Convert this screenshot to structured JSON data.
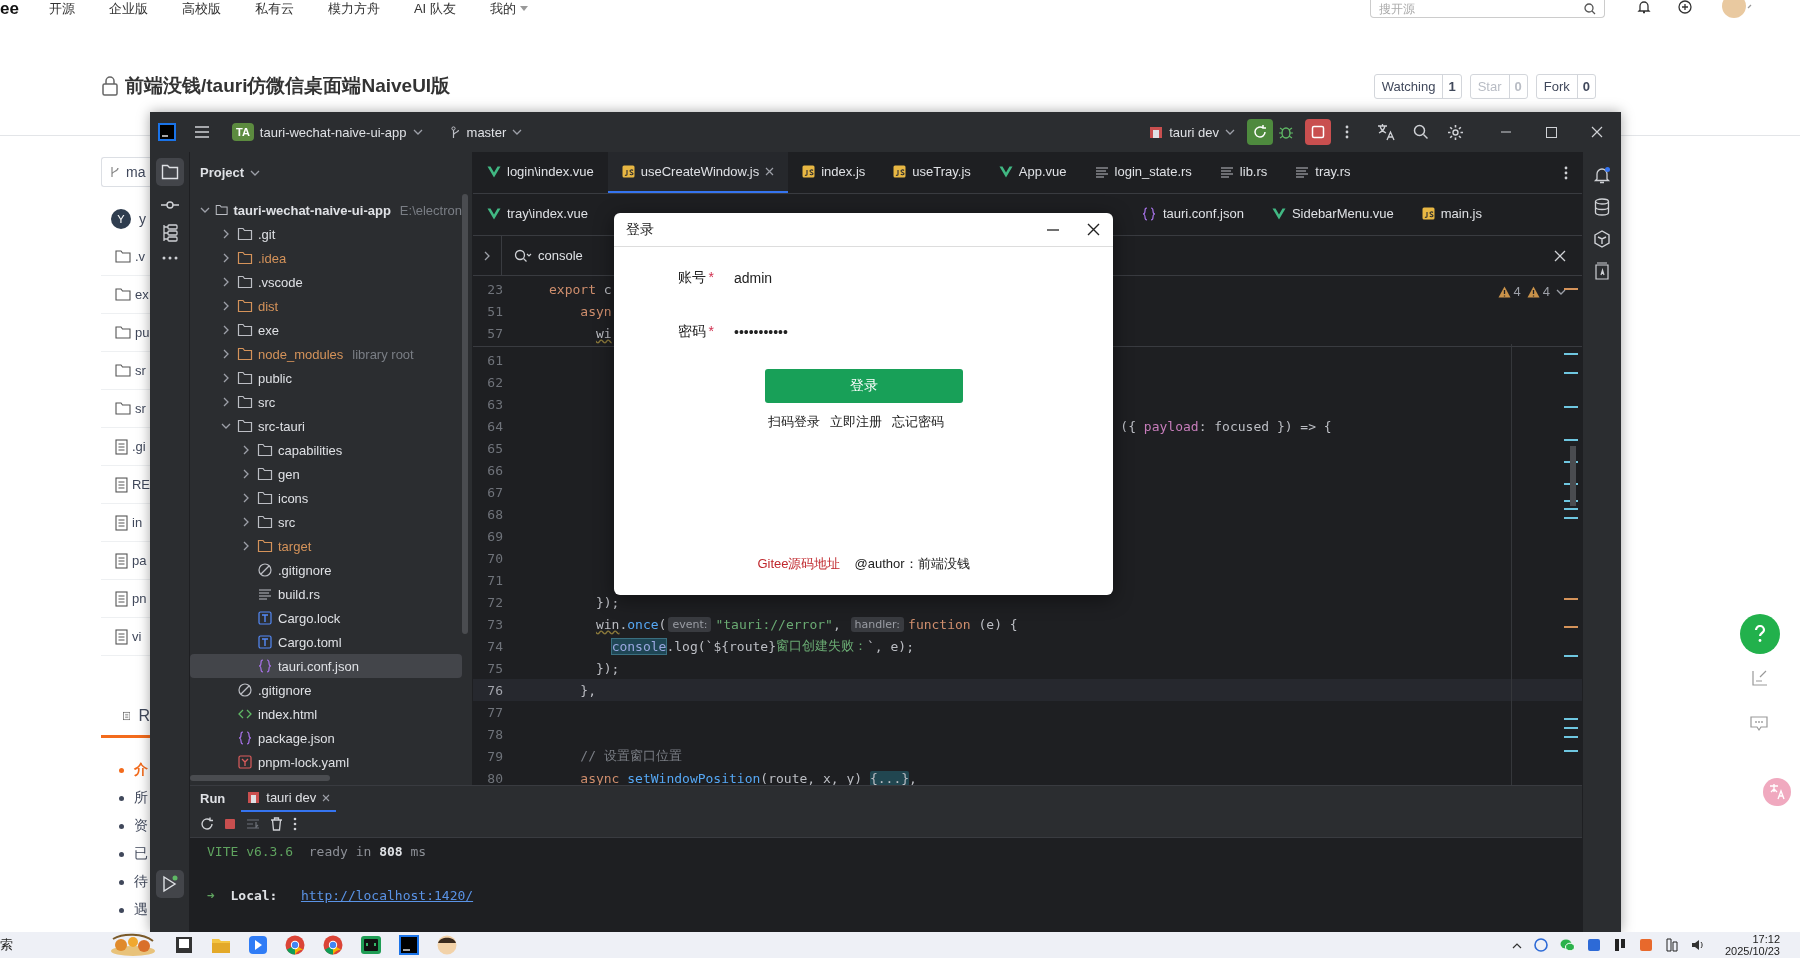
{
  "browser_page": {
    "logo": "ee",
    "nav": [
      "开源",
      "企业版",
      "高校版",
      "私有云",
      "模力方舟",
      "AI 队友",
      "我的"
    ],
    "search": {
      "placeholder": "搜开源"
    },
    "repo_title": "前端没钱/tauri仿微信桌面端NaiveUI版",
    "repo_buttons": [
      {
        "label": "Watching",
        "count": "1",
        "disabled": false
      },
      {
        "label": "Star",
        "count": "0",
        "disabled": true
      },
      {
        "label": "Fork",
        "count": "0",
        "disabled": false
      }
    ],
    "branch": "ma",
    "committer": {
      "avatar": "Y",
      "name": "y"
    },
    "files": [
      {
        "kind": "folder",
        "name": ".v"
      },
      {
        "kind": "folder",
        "name": "ex"
      },
      {
        "kind": "folder",
        "name": "pu"
      },
      {
        "kind": "folder",
        "name": "sr"
      },
      {
        "kind": "folder",
        "name": "sr"
      },
      {
        "kind": "file",
        "name": ".gi"
      },
      {
        "kind": "file",
        "name": "RE"
      },
      {
        "kind": "file",
        "name": "in"
      },
      {
        "kind": "file",
        "name": "pa"
      },
      {
        "kind": "file",
        "name": "pn"
      },
      {
        "kind": "file",
        "name": "vi"
      }
    ],
    "readme_tab": "R",
    "readme_items": [
      {
        "text": "介",
        "selected": true
      },
      {
        "text": "所",
        "selected": false
      },
      {
        "text": "资",
        "selected": false
      },
      {
        "text": "已",
        "selected": false
      },
      {
        "text": "待",
        "selected": false
      },
      {
        "text": "遇",
        "selected": false
      }
    ]
  },
  "ide": {
    "project_badge": "TA",
    "project": "tauri-wechat-naive-ui-app",
    "branch": "master",
    "run_config": "tauri dev",
    "panel_title": "Project",
    "tree": [
      {
        "name": "tauri-wechat-naive-ui-app",
        "note": "E:\\electron",
        "kind": "folder",
        "expanded": true,
        "excluded": false,
        "selected": false,
        "children": [
          {
            "name": ".git",
            "kind": "folder",
            "expanded": false,
            "excluded": false,
            "selected": false
          },
          {
            "name": ".idea",
            "kind": "folder",
            "expanded": false,
            "excluded": true,
            "selected": false
          },
          {
            "name": ".vscode",
            "kind": "folder",
            "expanded": false,
            "excluded": false,
            "selected": false
          },
          {
            "name": "dist",
            "kind": "folder",
            "expanded": false,
            "excluded": true,
            "selected": false
          },
          {
            "name": "exe",
            "kind": "folder",
            "expanded": false,
            "excluded": false,
            "selected": false
          },
          {
            "name": "node_modules",
            "note": "library root",
            "kind": "folder",
            "expanded": false,
            "excluded": true,
            "selected": false
          },
          {
            "name": "public",
            "kind": "folder",
            "expanded": false,
            "excluded": false,
            "selected": false
          },
          {
            "name": "src",
            "kind": "folder",
            "expanded": false,
            "excluded": false,
            "selected": false
          },
          {
            "name": "src-tauri",
            "kind": "folder",
            "expanded": true,
            "excluded": false,
            "selected": false,
            "children": [
              {
                "name": "capabilities",
                "kind": "folder",
                "expanded": false,
                "excluded": false,
                "selected": false
              },
              {
                "name": "gen",
                "kind": "folder",
                "expanded": false,
                "excluded": false,
                "selected": false
              },
              {
                "name": "icons",
                "kind": "folder",
                "expanded": false,
                "excluded": false,
                "selected": false
              },
              {
                "name": "src",
                "kind": "folder",
                "expanded": false,
                "excluded": false,
                "selected": false
              },
              {
                "name": "target",
                "kind": "folder",
                "expanded": false,
                "excluded": true,
                "selected": false
              },
              {
                "name": ".gitignore",
                "kind": "ignore",
                "excluded": false,
                "selected": false
              },
              {
                "name": "build.rs",
                "kind": "text",
                "excluded": false,
                "selected": false
              },
              {
                "name": "Cargo.lock",
                "kind": "toml",
                "excluded": false,
                "selected": false
              },
              {
                "name": "Cargo.toml",
                "kind": "toml",
                "excluded": false,
                "selected": false
              },
              {
                "name": "tauri.conf.json",
                "kind": "json",
                "excluded": false,
                "selected": true
              }
            ]
          },
          {
            "name": ".gitignore",
            "kind": "ignore",
            "excluded": false,
            "selected": false
          },
          {
            "name": "index.html",
            "kind": "html",
            "excluded": false,
            "selected": false
          },
          {
            "name": "package.json",
            "kind": "json",
            "excluded": false,
            "selected": false
          },
          {
            "name": "pnpm-lock.yaml",
            "kind": "yaml",
            "excluded": false,
            "selected": false
          }
        ]
      }
    ],
    "tabs": [
      {
        "label": "login\\index.vue",
        "kind": "vue",
        "selected": false
      },
      {
        "label": "useCreateWindow.js",
        "kind": "js",
        "selected": true
      },
      {
        "label": "index.js",
        "kind": "js",
        "selected": false
      },
      {
        "label": "useTray.js",
        "kind": "js",
        "selected": false
      },
      {
        "label": "App.vue",
        "kind": "vue",
        "selected": false
      },
      {
        "label": "login_state.rs",
        "kind": "rs",
        "selected": false
      },
      {
        "label": "lib.rs",
        "kind": "rs",
        "selected": false
      },
      {
        "label": "tray.rs",
        "kind": "rs",
        "selected": false
      }
    ],
    "tabs_second_row_left": [
      {
        "label": "tray\\index.vue",
        "kind": "vue",
        "selected": false
      }
    ],
    "tabs_second_row_right": [
      {
        "label": "tauri.conf.json",
        "kind": "json",
        "selected": false
      },
      {
        "label": "SidebarMenu.vue",
        "kind": "vue",
        "selected": false
      },
      {
        "label": "main.js",
        "kind": "js",
        "selected": false
      }
    ],
    "search": {
      "value": "console"
    },
    "warnings": [
      "4",
      "4"
    ],
    "sticky_lines": [
      {
        "number": "23",
        "tokens": [
          {
            "kind": "kw",
            "text": "export"
          },
          {
            "kind": "plain",
            "text": " c"
          }
        ]
      },
      {
        "number": "51",
        "tokens": [
          {
            "kind": "kw",
            "text": "    asyn"
          }
        ]
      },
      {
        "number": "57",
        "tokens": [
          {
            "kind": "squiggle",
            "text": "      wi"
          }
        ]
      }
    ],
    "lines": [
      {
        "number": "61",
        "current": false
      },
      {
        "number": "62",
        "current": false
      },
      {
        "number": "63",
        "current": false
      },
      {
        "number": "64",
        "current": false,
        "tail_tokens": [
          {
            "kind": "plain",
            "text": "({ "
          },
          {
            "kind": "prop",
            "text": "payload"
          },
          {
            "kind": "plain",
            "text": ": focused }) => {"
          }
        ]
      },
      {
        "number": "65",
        "current": false
      },
      {
        "number": "66",
        "current": false
      },
      {
        "number": "67",
        "current": false
      },
      {
        "number": "68",
        "current": false
      },
      {
        "number": "69",
        "current": false
      },
      {
        "number": "70",
        "current": false
      },
      {
        "number": "71",
        "current": false
      },
      {
        "number": "72",
        "current": false,
        "tokens": [
          {
            "kind": "plain",
            "text": "      });"
          }
        ]
      },
      {
        "number": "73",
        "current": false,
        "tokens": [
          {
            "kind": "squiggle",
            "text": "      win"
          },
          {
            "kind": "plain",
            "text": "."
          },
          {
            "kind": "fn",
            "text": "once"
          },
          {
            "kind": "plain",
            "text": "("
          },
          {
            "kind": "hint",
            "text": "event:"
          },
          {
            "kind": "str",
            "text": "\"tauri://error\""
          },
          {
            "kind": "plain",
            "text": ", "
          },
          {
            "kind": "hint",
            "text": "handler:"
          },
          {
            "kind": "kw",
            "text": "function"
          },
          {
            "kind": "plain",
            "text": " (e) {"
          }
        ]
      },
      {
        "number": "74",
        "current": false,
        "tokens": [
          {
            "kind": "match",
            "text": "        console"
          },
          {
            "kind": "plain",
            "text": ".log(`${route}"
          },
          {
            "kind": "str",
            "text": "窗口创建失败："
          },
          {
            "kind": "plain",
            "text": "`, e);"
          }
        ]
      },
      {
        "number": "75",
        "current": false,
        "tokens": [
          {
            "kind": "plain",
            "text": "      });"
          }
        ]
      },
      {
        "number": "76",
        "current": true,
        "tokens": [
          {
            "kind": "plain",
            "text": "    },"
          }
        ]
      },
      {
        "number": "77",
        "current": false
      },
      {
        "number": "78",
        "current": false
      },
      {
        "number": "79",
        "current": false,
        "tokens": [
          {
            "kind": "comment",
            "text": "    // 设置窗口位置"
          }
        ]
      },
      {
        "number": "80",
        "current": false,
        "tokens": [
          {
            "kind": "kw",
            "text": "    async"
          },
          {
            "kind": "fn",
            "text": " setWindowPosition"
          },
          {
            "kind": "plain",
            "text": "(route, x, y) "
          },
          {
            "kind": "fold",
            "text": "{...}"
          },
          {
            "kind": "plain",
            "text": ","
          }
        ]
      }
    ],
    "run_panel": {
      "title": "Run",
      "tab": "tauri dev",
      "console": [
        {
          "tokens": [
            {
              "kind": "vite",
              "text": "VITE v6.3.6"
            },
            {
              "kind": "dim",
              "text": "  ready in "
            },
            {
              "kind": "bold",
              "text": "808"
            },
            {
              "kind": "dim",
              "text": " ms"
            }
          ]
        },
        {
          "tokens": [
            {
              "kind": "vite",
              "text": "➜"
            },
            {
              "kind": "bold",
              "text": "  Local:   "
            },
            {
              "kind": "link",
              "text": "http://localhost:1420/"
            }
          ]
        }
      ]
    }
  },
  "login_dialog": {
    "title": "登录",
    "fields": [
      {
        "label": "账号",
        "required_mark": "*",
        "value": "admin"
      },
      {
        "label": "密码",
        "required_mark": "*",
        "value": "•••••••••••"
      }
    ],
    "submit": "登录",
    "links": [
      "扫码登录",
      "立即注册",
      "忘记密码"
    ],
    "footer_link": "Gitee源码地址",
    "footer_text": "@author：前端没钱"
  },
  "taskbar": {
    "search": "索",
    "apps": [
      {
        "kind": "picture"
      },
      {
        "kind": "taskview"
      },
      {
        "kind": "explorer"
      },
      {
        "kind": "arrow-app"
      },
      {
        "kind": "chrome"
      },
      {
        "kind": "chrome"
      },
      {
        "kind": "terminal"
      },
      {
        "kind": "webstorm"
      },
      {
        "kind": "avatar"
      }
    ],
    "time": "17:12",
    "date": "2025/10/23"
  }
}
